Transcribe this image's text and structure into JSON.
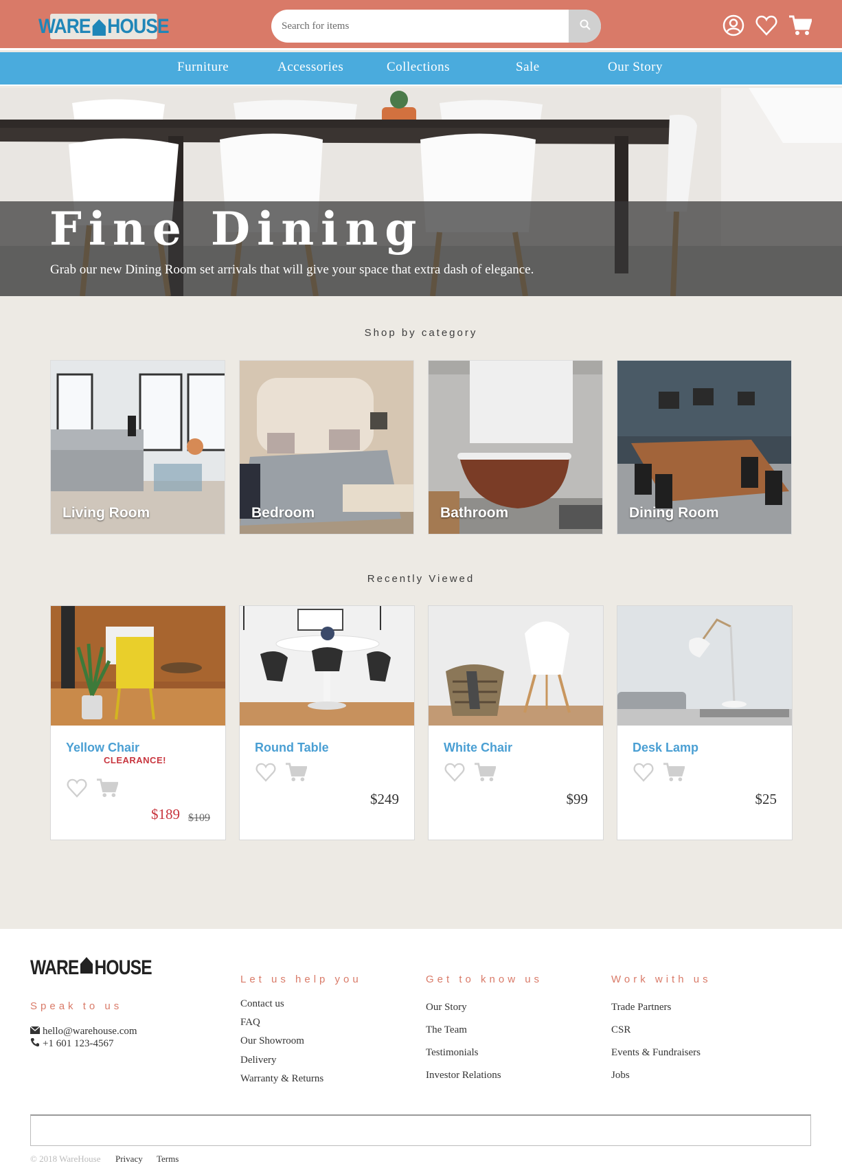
{
  "header": {
    "logo_left": "WARE",
    "logo_right": "HOUSE",
    "search_placeholder": "Search for items",
    "icons": [
      "account-icon",
      "heart-icon",
      "cart-icon"
    ]
  },
  "nav": {
    "items": [
      "Furniture",
      "Accessories",
      "Collections",
      "Sale",
      "Our Story"
    ]
  },
  "hero": {
    "title": "Fine Dining",
    "subtitle": "Grab our new Dining Room set arrivals that will give your space that extra dash of elegance."
  },
  "categories": {
    "title": "Shop by category",
    "items": [
      "Living Room",
      "Bedroom",
      "Bathroom",
      "Dining Room"
    ]
  },
  "recent": {
    "title": "Recently Viewed",
    "items": [
      {
        "name": "Yellow Chair",
        "badge": "CLEARANCE!",
        "price": "$189",
        "old_price": "$109"
      },
      {
        "name": "Round Table",
        "price": "$249"
      },
      {
        "name": "White Chair",
        "price": "$99"
      },
      {
        "name": "Desk Lamp",
        "price": "$25"
      }
    ]
  },
  "footer": {
    "logo_left": "WARE",
    "logo_right": "HOUSE",
    "speak_title": "Speak to us",
    "email": "hello@warehouse.com",
    "phone": "+1 601 123-4567",
    "help_title": "Let us help you",
    "help_links": [
      "Contact us",
      "FAQ",
      "Our Showroom",
      "Delivery",
      "Warranty & Returns"
    ],
    "know_title": "Get to know us",
    "know_links": [
      "Our Story",
      "The Team",
      "Testimonials",
      "Investor Relations"
    ],
    "work_title": "Work with us",
    "work_links": [
      "Trade Partners",
      "CSR",
      "Events & Fundraisers",
      "Jobs"
    ],
    "copyright": "© 2018 WareHouse",
    "privacy": "Privacy",
    "terms": "Terms"
  },
  "colors": {
    "header_bg": "#d97a68",
    "nav_bg": "#4aabdd",
    "accent_blue": "#4a9fd3",
    "sale_red": "#c8353e",
    "page_bg": "#edeae4"
  }
}
